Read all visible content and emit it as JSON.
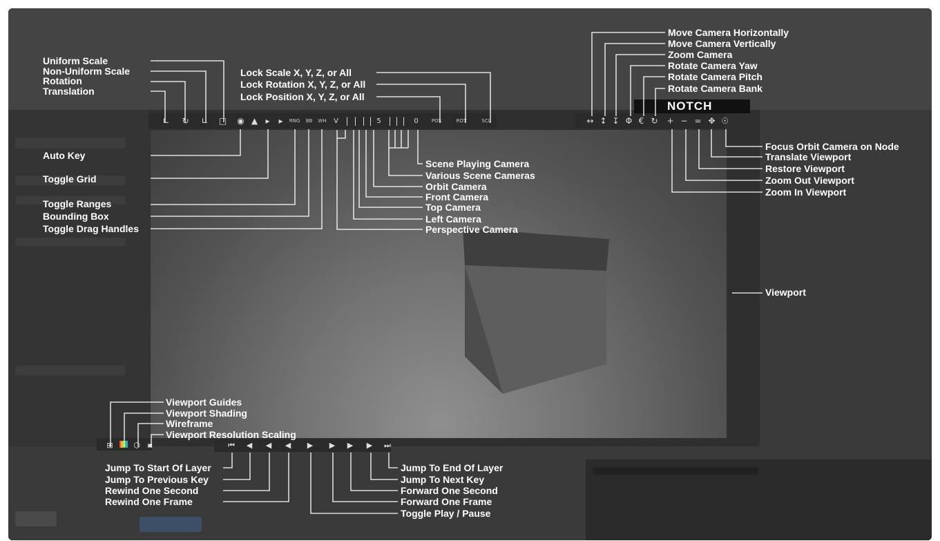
{
  "logo": {
    "text": "NOTCH"
  },
  "labels": {
    "uniform_scale": "Uniform Scale",
    "non_uniform_scale": "Non-Uniform Scale",
    "rotation": "Rotation",
    "translation": "Translation",
    "lock_scale": "Lock Scale X, Y, Z, or All",
    "lock_rotation": "Lock Rotation X, Y, Z, or All",
    "lock_position": "Lock Position X, Y, Z, or All",
    "move_cam_h": "Move Camera Horizontally",
    "move_cam_v": "Move Camera Vertically",
    "zoom_camera": "Zoom Camera",
    "rotate_yaw": "Rotate Camera Yaw",
    "rotate_pitch": "Rotate Camera Pitch",
    "rotate_bank": "Rotate Camera Bank",
    "auto_key": "Auto Key",
    "toggle_grid": "Toggle Grid",
    "toggle_ranges": "Toggle Ranges",
    "bounding_box": "Bounding Box",
    "toggle_drag_handles": "Toggle Drag Handles",
    "scene_playing_camera": "Scene Playing Camera",
    "various_scene_cameras": "Various Scene Cameras",
    "orbit_camera": "Orbit Camera",
    "front_camera": "Front Camera",
    "top_camera": "Top Camera",
    "left_camera": "Left Camera",
    "perspective_camera": "Perspective Camera",
    "focus_orbit": "Focus Orbit Camera on Node",
    "translate_viewport": "Translate Viewport",
    "restore_viewport": "Restore Viewport",
    "zoom_out_viewport": "Zoom Out Viewport",
    "zoom_in_viewport": "Zoom In Viewport",
    "viewport": "Viewport",
    "viewport_guides": "Viewport Guides",
    "viewport_shading": "Viewport Shading",
    "wireframe": "Wireframe",
    "viewport_res_scaling": "Viewport Resolution Scaling",
    "jump_start_layer": "Jump To Start Of Layer",
    "jump_prev_key": "Jump To Previous Key",
    "rewind_second": "Rewind One Second",
    "rewind_frame": "Rewind One Frame",
    "jump_end_layer": "Jump To End Of Layer",
    "jump_next_key": "Jump To Next Key",
    "forward_second": "Forward One Second",
    "forward_frame": "Forward One Frame",
    "toggle_play": "Toggle Play / Pause"
  },
  "toolbar": {
    "rng": "RNG",
    "bb": "BB",
    "wh": "WH",
    "v": "V",
    "cam_5": "5",
    "cam_0": "0",
    "pos": "POS",
    "rot": "ROT",
    "scl": "SCL"
  },
  "icons": {
    "translation": "translate-axes-icon",
    "rotation": "rotate-icon",
    "non_uniform_scale": "scale-axes-icon",
    "uniform_scale": "uniform-scale-icon",
    "auto_key": "auto-key-icon",
    "toggle_grid": "grid-icon"
  },
  "colors": {
    "accent_logo": "#e8412c",
    "label": "#ffffff",
    "line": "#ffffff"
  }
}
